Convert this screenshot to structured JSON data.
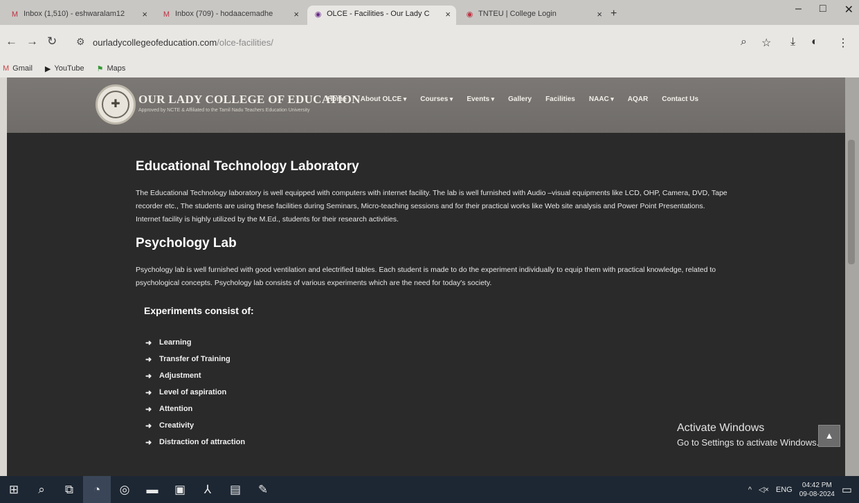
{
  "browser": {
    "tabs": [
      {
        "title": "Inbox (1,510) - eshwaralam12",
        "icon": "gmail-icon",
        "active": false
      },
      {
        "title": "Inbox (709) - hodaacemadhe",
        "icon": "gmail-icon",
        "active": false
      },
      {
        "title": "OLCE - Facilities - Our Lady C",
        "icon": "site-icon",
        "active": true
      },
      {
        "title": "TNTEU | College Login",
        "icon": "site-icon",
        "active": false
      }
    ],
    "new_tab_label": "+",
    "url_host": "ourladycollegeofeducation.com",
    "url_path": "/olce-facilities/",
    "bookmarks": [
      {
        "label": "Gmail",
        "icon": "gmail-icon"
      },
      {
        "label": "YouTube",
        "icon": "youtube-icon"
      },
      {
        "label": "Maps",
        "icon": "maps-icon"
      }
    ]
  },
  "site": {
    "brand_name": "OUR LADY COLLEGE OF EDUCATION",
    "brand_sub": "Approved by NCTE & Affiliated to the Tamil Nadu Teachers Education University",
    "nav": [
      {
        "label": "Home",
        "caret": false
      },
      {
        "label": "About OLCE",
        "caret": true
      },
      {
        "label": "Courses",
        "caret": true
      },
      {
        "label": "Events",
        "caret": true
      },
      {
        "label": "Gallery",
        "caret": false
      },
      {
        "label": "Facilities",
        "caret": false
      },
      {
        "label": "NAAC",
        "caret": true
      },
      {
        "label": "AQAR",
        "caret": false
      },
      {
        "label": "Contact Us",
        "caret": false
      }
    ]
  },
  "content": {
    "section1_title": "Educational Technology Laboratory",
    "section1_text": "The Educational Technology laboratory is well equipped with computers with internet facility. The lab is well furnished with Audio –visual equipments like LCD, OHP, Camera, DVD, Tape recorder etc., The students are using these facilities during Seminars, Micro-teaching sessions and for their practical works like Web site analysis and Power Point Presentations. Internet facility is highly utilized by the M.Ed., students for their research activities.",
    "section2_title": "Psychology Lab",
    "section2_text": "Psychology lab is well furnished with good ventilation and electrified tables. Each student is made to do the experiment individually to equip them with practical knowledge, related to psychological concepts. Psychology lab consists of various experiments which are the need for today's society.",
    "experiments_heading": "Experiments consist of:",
    "experiments": [
      "Learning",
      "Transfer of Training",
      "Adjustment",
      "Level of aspiration",
      "Attention",
      "Creativity",
      "Distraction of attraction"
    ]
  },
  "overlay": {
    "activate_title": "Activate Windows",
    "activate_sub": "Go to Settings to activate Windows."
  },
  "taskbar": {
    "language": "ENG",
    "time": "04:42 PM",
    "date": "09-08-2024"
  }
}
